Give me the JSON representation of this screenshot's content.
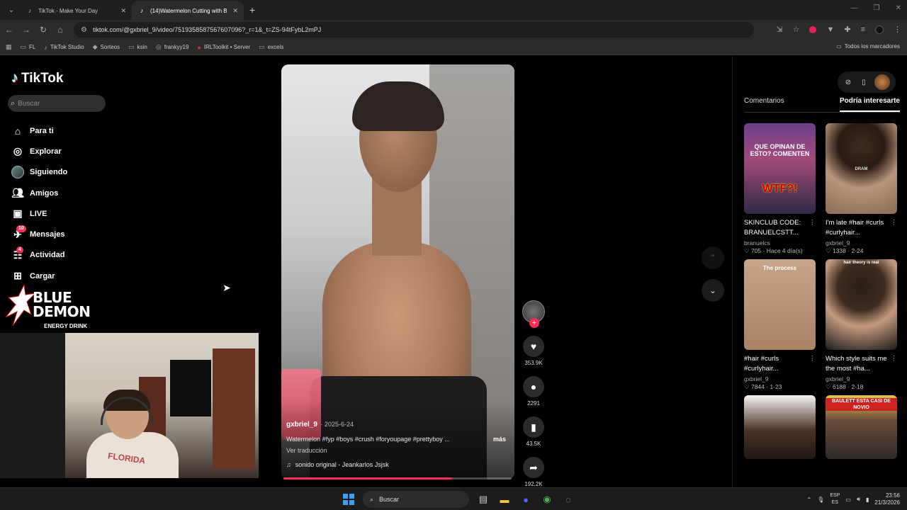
{
  "browser": {
    "tabs": [
      {
        "title": "TikTok - Make Your Day",
        "active": false
      },
      {
        "title": "(14)Watermelon Cutting with B",
        "active": true
      }
    ],
    "url": "tiktok.com/@gxbriel_9/video/7519358587567607096?_r=1&_t=ZS-94tFybL2mPJ",
    "bookmarks": [
      "FL",
      "TikTok Studio",
      "Sorteos",
      "ksin",
      "frankyy19",
      "IRLToolkit • Server",
      "excels"
    ],
    "all_bookmarks": "Todos los marcadores"
  },
  "sidebar": {
    "logo": "TikTok",
    "search_placeholder": "Buscar",
    "items": [
      {
        "label": "Para ti",
        "icon": "home-icon"
      },
      {
        "label": "Explorar",
        "icon": "compass-icon"
      },
      {
        "label": "Siguiendo",
        "icon": "avatar-icon"
      },
      {
        "label": "Amigos",
        "icon": "friends-icon"
      },
      {
        "label": "LIVE",
        "icon": "live-icon"
      },
      {
        "label": "Mensajes",
        "icon": "message-icon",
        "badge": "10"
      },
      {
        "label": "Actividad",
        "icon": "activity-icon",
        "badge": "4"
      },
      {
        "label": "Cargar",
        "icon": "upload-icon"
      }
    ]
  },
  "overlay": {
    "brand_title": "BLUE\nDEMON",
    "brand_sub": "ENERGY DRINK"
  },
  "webcam": {
    "shirt_text": "FLORIDA"
  },
  "video": {
    "author": "gxbriel_9",
    "date": "· 2025-6-24",
    "description": "Watermelon #fyp #boys #crush #foryoupage #prettyboy ...",
    "more": "más",
    "translate": "Ver traducción",
    "music": "sonido original - Jeankarlos Jsjsk",
    "progress": 0.74
  },
  "actions": {
    "likes": "353.9K",
    "comments": "2291",
    "saves": "43.5K",
    "shares": "192.2K"
  },
  "right_panel": {
    "tabs": [
      "Comentarios",
      "Podría interesarte"
    ],
    "active_tab": 1,
    "cards": [
      {
        "title": "SKINCLUB CODE: BRANUELCSTT...",
        "user": "branuelcs",
        "stats": "♡ 705 · Hace 4 día(s)",
        "thumb_text": "QUE OPINAN DE ESTO? COMENTEN",
        "thumb_sticker": "WTF?!"
      },
      {
        "title": "I'm late #hair #curls #curlyhair...",
        "user": "gxbriel_9",
        "stats": "♡ 1338 · 2-24",
        "thumb_text": "DRAM"
      },
      {
        "title": "#hair #curls #curlyhair...",
        "user": "gxbriel_9",
        "stats": "♡ 7844 · 1-23",
        "thumb_text": "The process"
      },
      {
        "title": "Which style suits me the most #ha...",
        "user": "gxbriel_9",
        "stats": "♡ 6188 · 2-18",
        "thumb_text": "hair theory is real"
      },
      {
        "title": "",
        "user": "",
        "stats": "",
        "thumb_text": ""
      },
      {
        "title": "",
        "user": "",
        "stats": "",
        "thumb_text": "BAULETT ESTA CASI DE NOVIO"
      }
    ]
  },
  "taskbar": {
    "search": "Buscar",
    "lang_top": "ESP",
    "lang_bottom": "ES",
    "time": "23:56",
    "date": "21/3/2026"
  }
}
